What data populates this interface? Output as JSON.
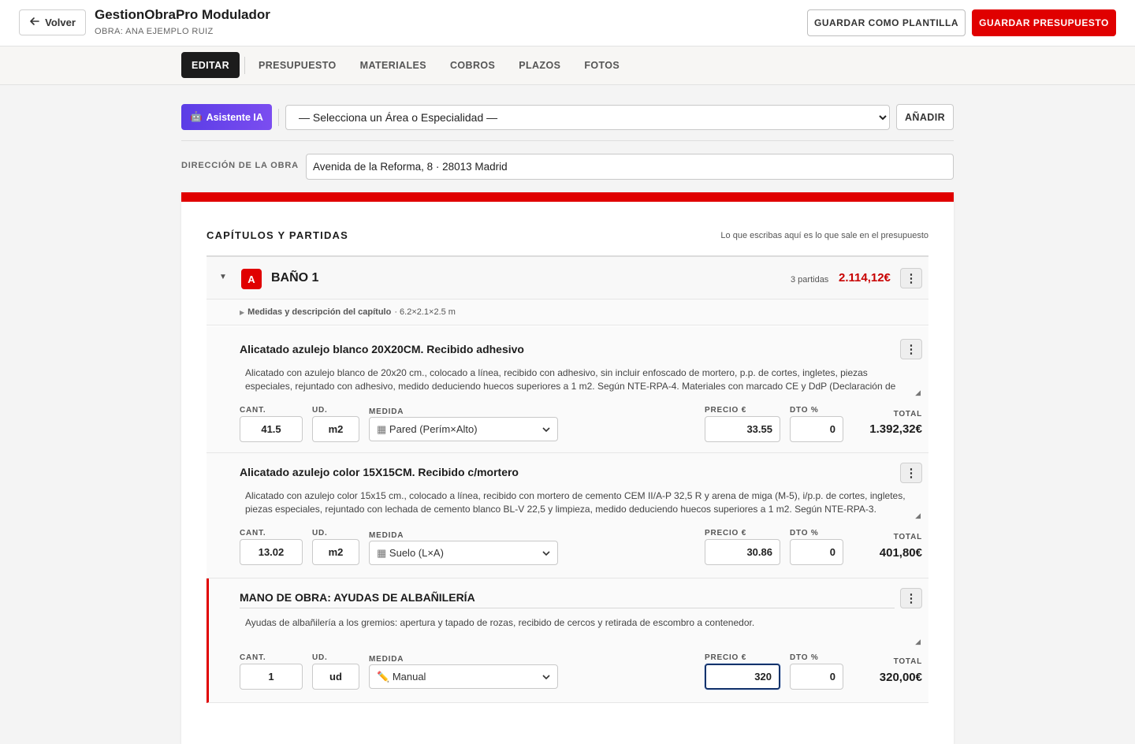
{
  "header": {
    "back_label": "Volver",
    "app_title": "GestionObraPro Modulador",
    "obra_label": "OBRA: ANA EJEMPLO RUIZ",
    "save_template_label": "GUARDAR COMO PLANTILLA",
    "save_budget_label": "GUARDAR PRESUPUESTO"
  },
  "tabs": [
    {
      "label": "EDITAR",
      "active": true
    },
    {
      "label": "PRESUPUESTO",
      "active": false
    },
    {
      "label": "MATERIALES",
      "active": false
    },
    {
      "label": "COBROS",
      "active": false
    },
    {
      "label": "PLAZOS",
      "active": false
    },
    {
      "label": "FOTOS",
      "active": false
    }
  ],
  "toolbar": {
    "ai_label": "Asistente IA",
    "area_select_value": "— Selecciona un Área o Especialidad —",
    "add_label": "AÑADIR"
  },
  "direccion": {
    "label": "DIRECCIÓN DE LA OBRA",
    "value": "Avenida de la Reforma, 8 · 28013 Madrid"
  },
  "capitulos": {
    "title": "CAPÍTULOS Y PARTIDAS",
    "note": "Lo que escribas aquí es lo que sale en el presupuesto"
  },
  "chapter": {
    "badge": "A",
    "name": "BAÑO 1",
    "count": "3 partidas",
    "total": "2.114,12€",
    "measures_label": "Medidas y descripción del capítulo",
    "measures_value": "· 6.2×2.1×2.5 m"
  },
  "field_labels": {
    "cant": "CANT.",
    "ud": "UD.",
    "medida": "MEDIDA",
    "precio": "PRECIO €",
    "dto": "DTO %",
    "total": "TOTAL"
  },
  "items": [
    {
      "title": "Alicatado azulejo blanco 20X20CM. Recibido adhesivo",
      "description": "Alicatado con azulejo blanco de 20x20 cm., colocado a línea, recibido con adhesivo, sin incluir enfoscado de mortero, p.p. de cortes, ingletes, piezas especiales, rejuntado con adhesivo, medido deduciendo huecos superiores a 1 m2. Según NTE-RPA-4. Materiales con marcado CE y DdP (Declaración de",
      "cant": "41.5",
      "ud": "m2",
      "medida_icon": "▦",
      "medida": "Pared (Perím×Alto)",
      "precio": "33.55",
      "dto": "0",
      "total": "1.392,32€"
    },
    {
      "title": "Alicatado azulejo color 15X15CM. Recibido c/mortero",
      "description": "Alicatado con azulejo color 15x15 cm., colocado a línea, recibido con mortero de cemento CEM II/A-P 32,5 R y arena de miga (M-5), i/p.p. de cortes, ingletes, piezas especiales, rejuntado con lechada de cemento blanco BL-V 22,5 y limpieza, medido deduciendo huecos superiores a 1 m2. Según NTE-RPA-3.",
      "cant": "13.02",
      "ud": "m2",
      "medida_icon": "▦",
      "medida": "Suelo (L×A)",
      "precio": "30.86",
      "dto": "0",
      "total": "401,80€"
    },
    {
      "title": "MANO DE OBRA: AYUDAS DE ALBAÑILERÍA",
      "description": "Ayudas de albañilería a los gremios: apertura y tapado de rozas, recibido de cercos y retirada de escombro a contenedor.",
      "cant": "1",
      "ud": "ud",
      "medida_icon": "✏️",
      "medida": "Manual",
      "precio": "320",
      "dto": "0",
      "total": "320,00€"
    }
  ],
  "colors": {
    "brand_red": "#e00000",
    "ai_purple": "#6a45ec",
    "dark": "#1c1c1c"
  }
}
